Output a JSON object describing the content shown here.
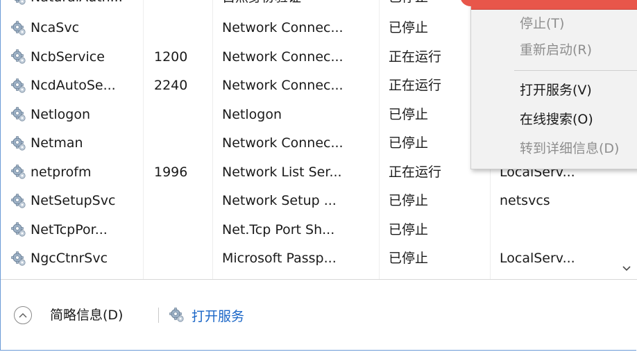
{
  "table": {
    "partial_row": {
      "name": "NaturalAuth...",
      "desc": "自然身份验证",
      "status": "已停止"
    },
    "rows": [
      {
        "name": "NcaSvc",
        "pid": "",
        "desc": "Network Connec...",
        "status": "已停止",
        "group": ""
      },
      {
        "name": "NcbService",
        "pid": "1200",
        "desc": "Network Connec...",
        "status": "正在运行",
        "group": ""
      },
      {
        "name": "NcdAutoSe...",
        "pid": "2240",
        "desc": "Network Connec...",
        "status": "正在运行",
        "group": ""
      },
      {
        "name": "Netlogon",
        "pid": "",
        "desc": "Netlogon",
        "status": "已停止",
        "group": ""
      },
      {
        "name": "Netman",
        "pid": "",
        "desc": "Network Connec...",
        "status": "已停止",
        "group": ""
      },
      {
        "name": "netprofm",
        "pid": "1996",
        "desc": "Network List Ser...",
        "status": "正在运行",
        "group": "LocalServ..."
      },
      {
        "name": "NetSetupSvc",
        "pid": "",
        "desc": "Network Setup ...",
        "status": "已停止",
        "group": "netsvcs"
      },
      {
        "name": "NetTcpPor...",
        "pid": "",
        "desc": "Net.Tcp Port Sh...",
        "status": "已停止",
        "group": ""
      },
      {
        "name": "NgcCtnrSvc",
        "pid": "",
        "desc": "Microsoft Passp...",
        "status": "已停止",
        "group": "LocalServ..."
      }
    ]
  },
  "context_menu": {
    "items": [
      {
        "label": "停止(T)",
        "enabled": false
      },
      {
        "label": "重新启动(R)",
        "enabled": false
      },
      {
        "label": "打开服务(V)",
        "enabled": true
      },
      {
        "label": "在线搜索(O)",
        "enabled": true
      },
      {
        "label": "转到详细信息(D)",
        "enabled": false
      }
    ]
  },
  "footer": {
    "collapse_label": "简略信息(D)",
    "open_services_label": "打开服务"
  },
  "colors": {
    "link": "#1a66c7",
    "disabled_text": "#8e8e8e",
    "highlight": "#e8564a"
  },
  "icons": {
    "service": "gear-icon",
    "collapse": "chevron-up-icon",
    "scroll": "chevron-down-icon"
  }
}
